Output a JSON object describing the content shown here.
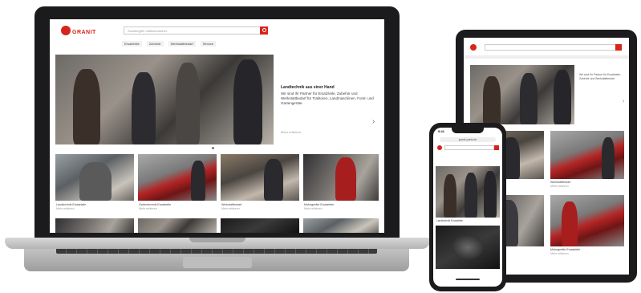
{
  "brand": {
    "name": "GRANIT",
    "accent": "#d6241c"
  },
  "laptop": {
    "search_placeholder": "Suchbegriff / Artikelnummer",
    "nav": [
      "Ersatzteile",
      "Zubehör",
      "Werkstattbedarf",
      "Service"
    ],
    "hero": {
      "title": "Landtechnik aus einer Hand",
      "text": "Wir sind Ihr Partner für Ersatzteile, Zubehör und Werkstattbedarf für Traktoren, Landmaschinen, Forst- und Gartengeräte.",
      "link": "Mehr erfahren"
    },
    "cards": [
      {
        "title": "Landtechnik Ersatzteile",
        "sub": "Mehr erfahren"
      },
      {
        "title": "Gartentechnik Ersatzteile",
        "sub": "Mehr erfahren"
      },
      {
        "title": "Werkstattbedarf",
        "sub": "Mehr erfahren"
      },
      {
        "title": "Motorgeräte Ersatzteile",
        "sub": "Mehr erfahren"
      }
    ]
  },
  "tablet": {
    "hero_text": "Wir sind Ihr Partner für Ersatzteile, Zubehör und Werkstattbedarf.",
    "cards": [
      {
        "title": "Werkstattbedarf",
        "sub": "Mehr erfahren"
      },
      {
        "title": "Motorgeräte Ersatzteile",
        "sub": "Mehr erfahren"
      }
    ]
  },
  "phone": {
    "time": "9:41",
    "url": "granit-parts.de",
    "caption": "Landtechnik Ersatzteile"
  }
}
